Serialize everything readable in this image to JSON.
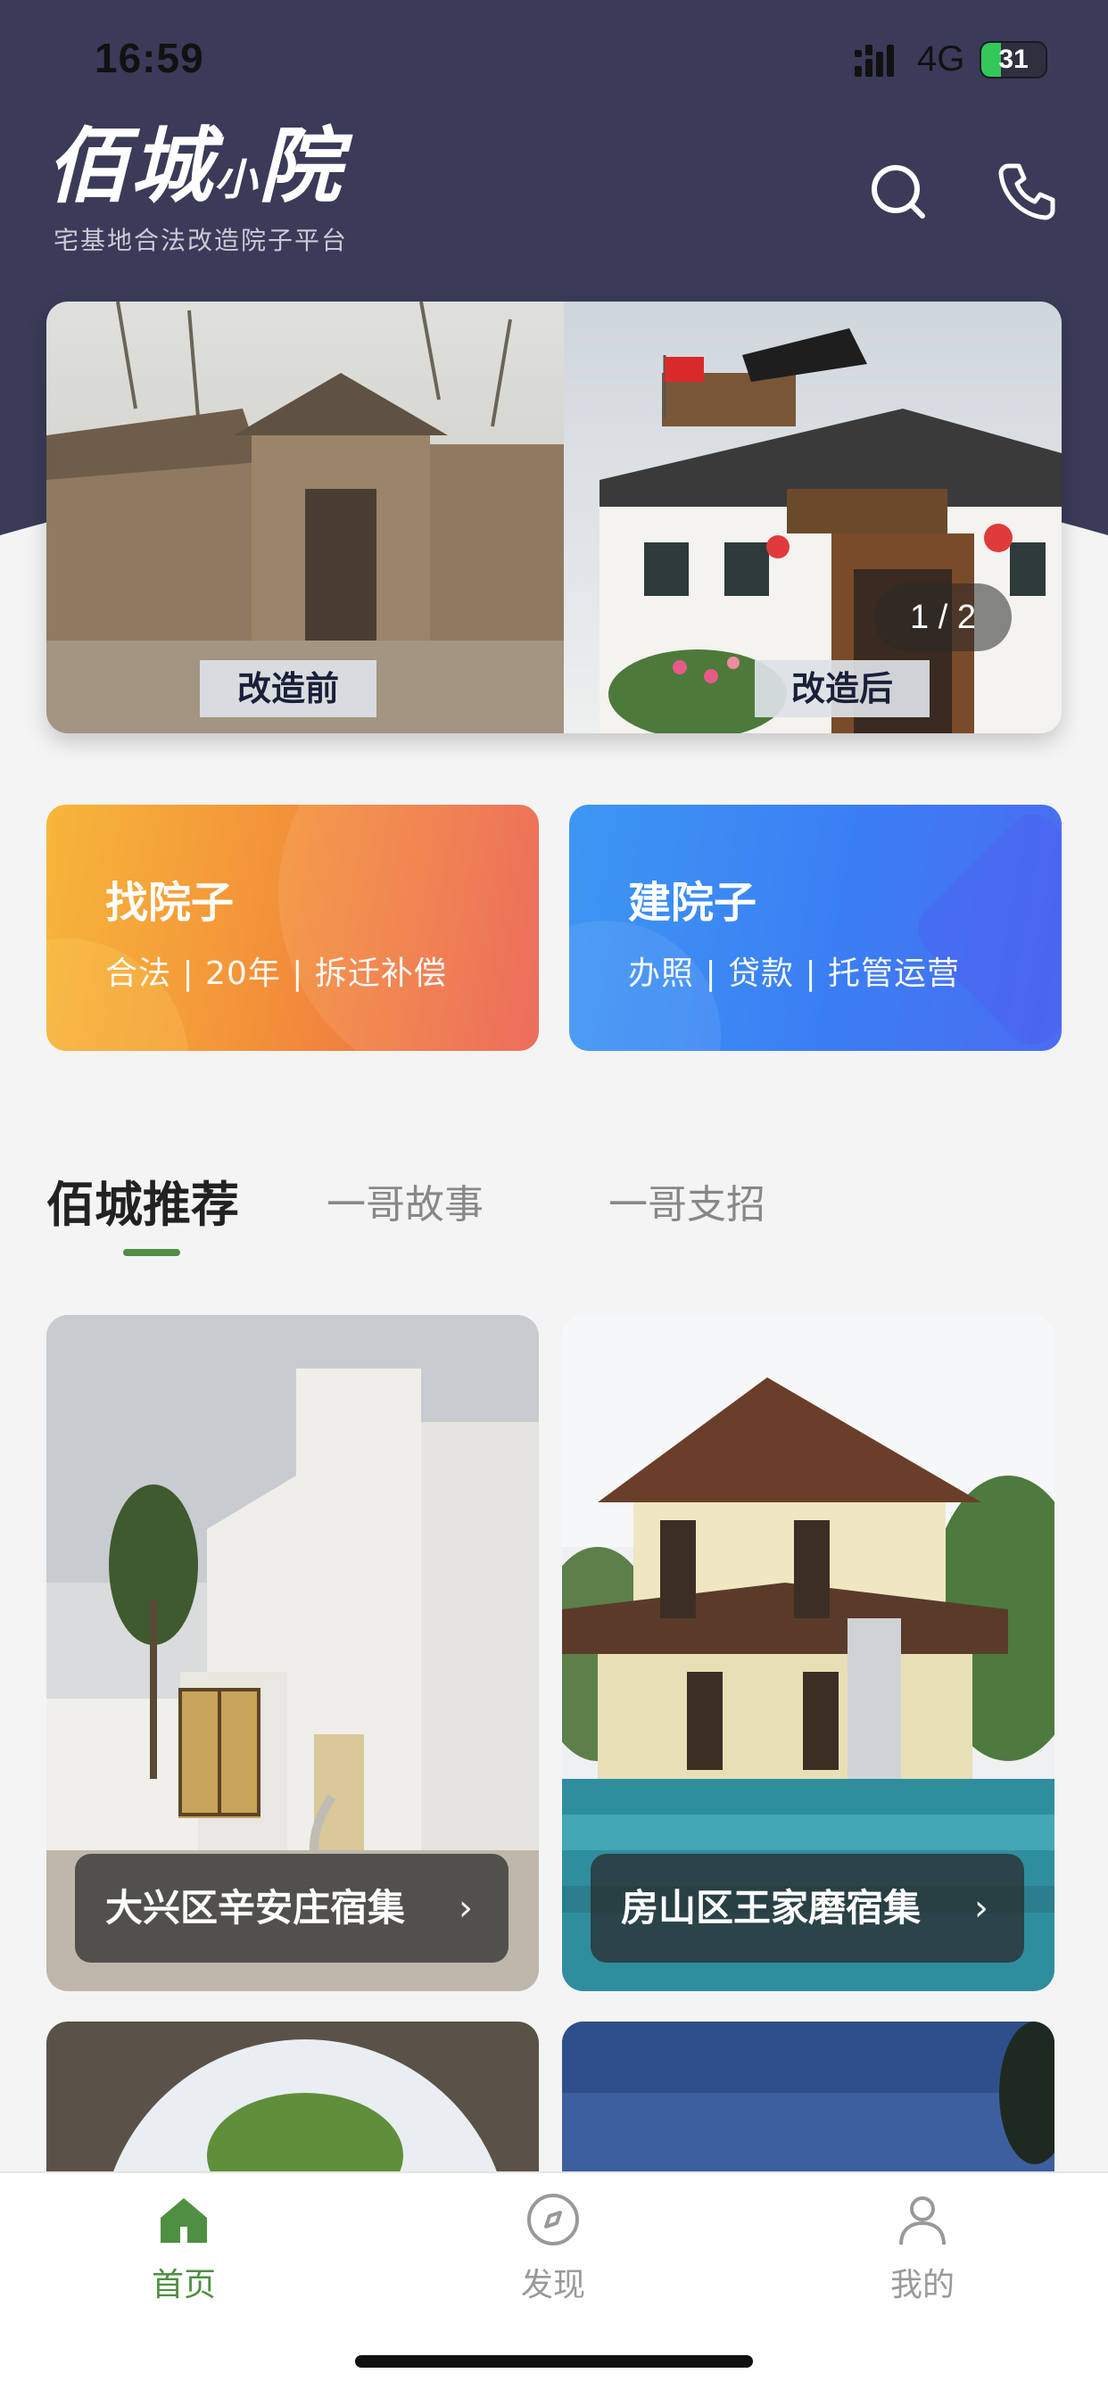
{
  "status_bar": {
    "time": "16:59",
    "network": "4G",
    "battery": "31"
  },
  "header": {
    "logo_main": "佰城",
    "logo_small": "小",
    "logo_end": "院",
    "slogan": "宅基地合法改造院子平台",
    "search_icon": "search-icon",
    "phone_icon": "phone-icon"
  },
  "banner": {
    "before_label": "改造前",
    "after_label": "改造后",
    "pager": "1 / 2",
    "current_page": 1,
    "total_pages": 2
  },
  "services": [
    {
      "title": "找院子",
      "desc": "合法 | 20年 | 拆迁补偿"
    },
    {
      "title": "建院子",
      "desc": "办照 | 贷款 | 托管运营"
    }
  ],
  "tabs": [
    {
      "label": "佰城推荐",
      "active": true
    },
    {
      "label": "一哥故事",
      "active": false
    },
    {
      "label": "一哥支招",
      "active": false
    }
  ],
  "listings": [
    {
      "title": "大兴区辛安庄宿集",
      "chevron": "›"
    },
    {
      "title": "房山区王家磨宿集",
      "chevron": "›"
    }
  ],
  "bottom_nav": [
    {
      "label": "首页",
      "icon": "home-icon",
      "active": true
    },
    {
      "label": "发现",
      "icon": "compass-icon",
      "active": false
    },
    {
      "label": "我的",
      "icon": "user-icon",
      "active": false
    }
  ],
  "colors": {
    "header_bg": "#3a3b58",
    "accent_green": "#4f8f42",
    "find_card": "#f39239",
    "build_card": "#3b7ef4"
  }
}
